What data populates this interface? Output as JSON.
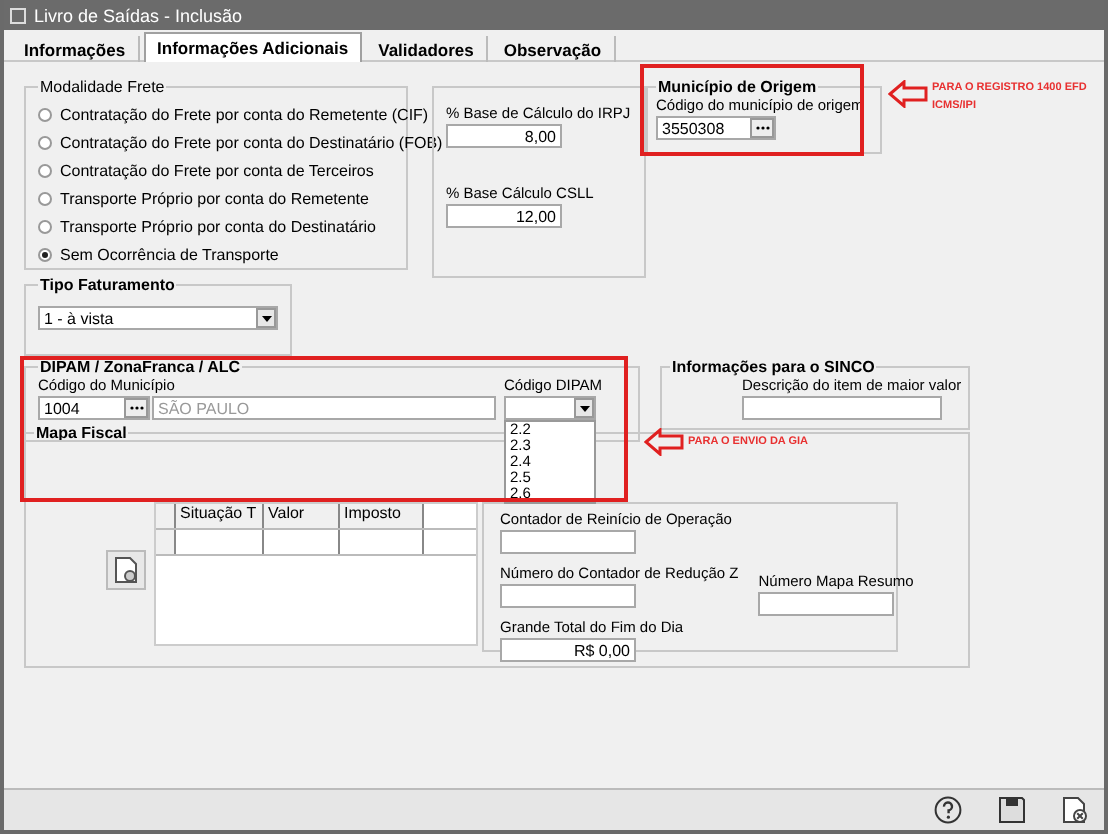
{
  "window": {
    "title": "Livro de Saídas - Inclusão"
  },
  "tabs": [
    {
      "label": "Informações",
      "selected": false
    },
    {
      "label": "Informações Adicionais",
      "selected": true
    },
    {
      "label": "Validadores",
      "selected": false
    },
    {
      "label": "Observação",
      "selected": false
    }
  ],
  "modalidade_frete": {
    "legend": "Modalidade Frete",
    "options": [
      {
        "label": "Contratação do Frete por conta do Remetente (CIF)",
        "selected": false
      },
      {
        "label": "Contratação do Frete por conta do Destinatário (FOB)",
        "selected": false
      },
      {
        "label": "Contratação do Frete por conta de Terceiros",
        "selected": false
      },
      {
        "label": "Transporte Próprio por conta do Remetente",
        "selected": false
      },
      {
        "label": "Transporte Próprio por conta do Destinatário",
        "selected": false
      },
      {
        "label": "Sem Ocorrência de Transporte",
        "selected": true
      }
    ]
  },
  "bases": [
    {
      "label": "% Base de Cálculo do IRPJ",
      "value": "8,00"
    },
    {
      "label": "% Base Cálculo CSLL",
      "value": "12,00"
    }
  ],
  "municipio_origem": {
    "legend": "Município de Origem",
    "label": "Código do município de origem",
    "value": "3550308"
  },
  "note_registro": {
    "lines": [
      "PARA O REGISTRO 1400 EFD",
      "ICMS/IPI"
    ]
  },
  "tipo_faturamento": {
    "legend": "Tipo Faturamento",
    "value": "1 - à vista"
  },
  "dipam": {
    "legend": "DIPAM / ZonaFranca / ALC",
    "municipio_label": "Código do Município",
    "municipio_code": "1004",
    "municipio_name": "SÃO PAULO",
    "dipam_label": "Código DIPAM",
    "dipam_options": [
      "2.2",
      "2.3",
      "2.4",
      "2.5",
      "2.6"
    ]
  },
  "note_gia": {
    "text": "PARA O ENVIO DA GIA"
  },
  "sinco": {
    "legend": "Informações para o SINCO",
    "label": "Descrição do item de maior valor"
  },
  "mapa_fiscal": {
    "legend": "Mapa Fiscal",
    "columns": [
      "Situação T",
      "Valor",
      "Imposto"
    ],
    "fields": [
      {
        "label": "Contador de Reinício de Operação"
      },
      {
        "label": "Número do Contador de Redução Z"
      },
      {
        "label": "Grande Total do Fim do Dia",
        "value": "R$ 0,00"
      }
    ],
    "resumo_label": "Número Mapa Resumo"
  }
}
